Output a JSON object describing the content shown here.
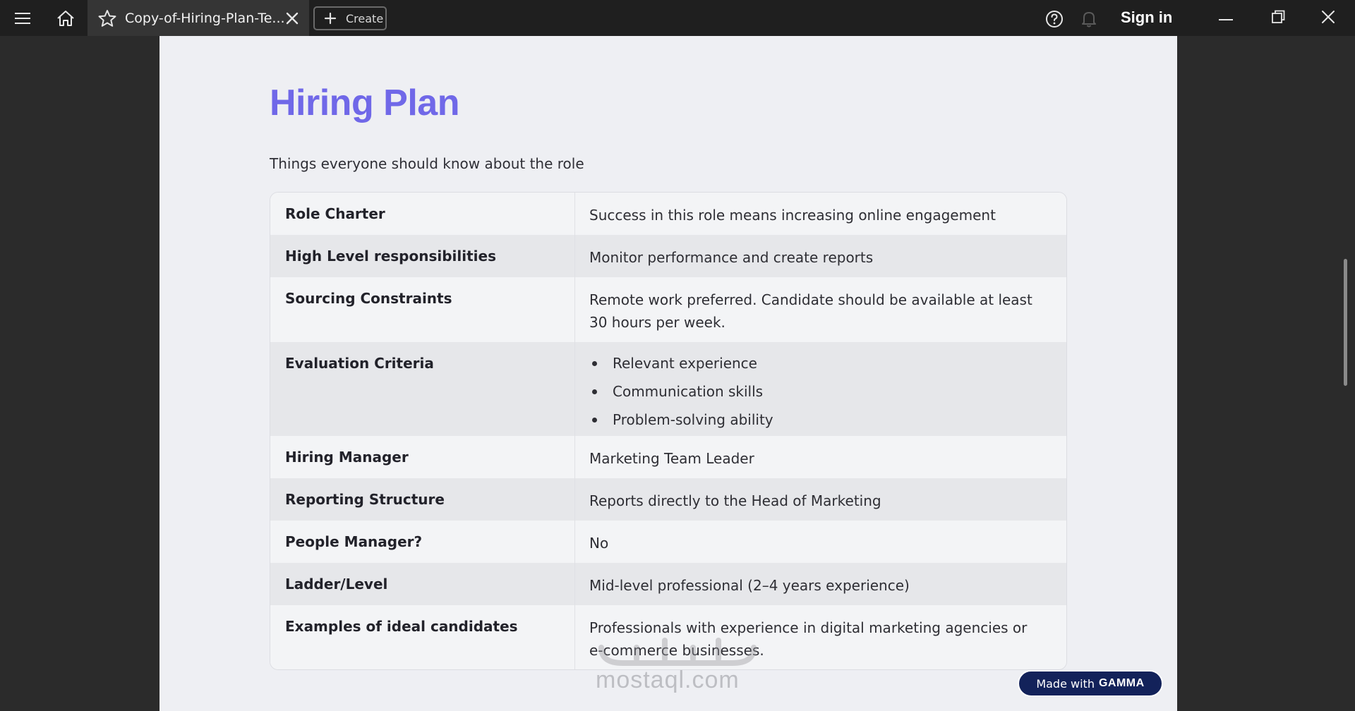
{
  "titlebar": {
    "tab_title": "Copy-of-Hiring-Plan-Te...",
    "create_label": "Create",
    "signin_label": "Sign in",
    "icons": {
      "menu": "hamburger-menu-icon",
      "home": "home-icon",
      "star": "star-icon",
      "close_tab": "close-icon",
      "create": "plus-icon",
      "help": "help-icon",
      "bell": "bell-icon",
      "minimize": "minimize-icon",
      "maximize": "maximize-icon",
      "close_window": "close-icon"
    }
  },
  "document": {
    "heading": "Hiring Plan",
    "subtitle": "Things everyone should know about the role",
    "rows": [
      {
        "label": "Role Charter",
        "value": "Success in this role means increasing online engagement"
      },
      {
        "label": "High Level responsibilities",
        "value": "Monitor performance and create reports"
      },
      {
        "label": "Sourcing Constraints",
        "value": "Remote work preferred. Candidate should be available at least 30 hours per week."
      },
      {
        "label": "Evaluation Criteria",
        "bullets": [
          "Relevant experience",
          "Communication skills",
          "Problem-solving ability"
        ]
      },
      {
        "label": "Hiring Manager",
        "value": "Marketing Team Leader"
      },
      {
        "label": "Reporting Structure",
        "value": "Reports directly to the Head of Marketing"
      },
      {
        "label": "People Manager?",
        "value": "No"
      },
      {
        "label": "Ladder/Level",
        "value": "Mid-level professional (2–4 years experience)"
      },
      {
        "label": "Examples of ideal candidates",
        "value": "Professionals with experience in digital marketing agencies or e-commerce businesses."
      }
    ]
  },
  "badge": {
    "prefix": "Made with",
    "brand": "GAMMA"
  },
  "watermark": {
    "text": "mostaql.com"
  },
  "colors": {
    "heading": "#7068e8",
    "badge_bg": "#13225a",
    "page_bg": "#eeeff3",
    "titlebar_bg": "#1f1f1f"
  }
}
